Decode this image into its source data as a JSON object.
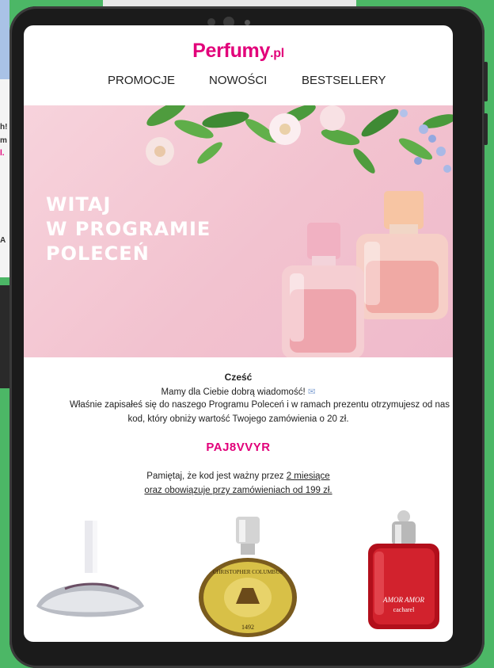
{
  "email": {
    "brand": {
      "name": "Perfumy",
      "suffix": ".pl",
      "color": "#e2007a"
    },
    "nav": [
      {
        "label": "PROMOCJE"
      },
      {
        "label": "NOWOŚCI"
      },
      {
        "label": "BESTSELLERY"
      }
    ],
    "hero": {
      "title_lines": [
        "WITAJ",
        "W PROGRAMIE",
        "POLECEŃ"
      ]
    },
    "body": {
      "greeting": "Cześć",
      "line1": "Mamy dla Ciebie dobrą wiadomość!",
      "line2": "Właśnie zapisałeś się do naszego Programu Poleceń i w ramach prezentu otrzymujesz od nas",
      "line3": "kod, który obniży wartość Twojego zamówienia o 20 zł.",
      "code": "PAJ8VVYR",
      "reminder_prefix": "Pamiętaj, że kod jest ważny przez ",
      "reminder_link1": "2 miesiące",
      "reminder_link2": "oraz obowiązuje przy zamówieniach od 199 zł."
    },
    "products": [
      {
        "icon": "perfume-bottle-silver-icon"
      },
      {
        "icon": "perfume-bottle-gold-icon",
        "label": "CHRISTOPHER COLUMBUS",
        "year": "1492"
      },
      {
        "icon": "perfume-bottle-red-icon",
        "label": "AMOR AMOR",
        "brand": "cacharel"
      }
    ]
  },
  "background": {
    "left_text": [
      "h!",
      "m",
      "l.",
      "A"
    ]
  }
}
